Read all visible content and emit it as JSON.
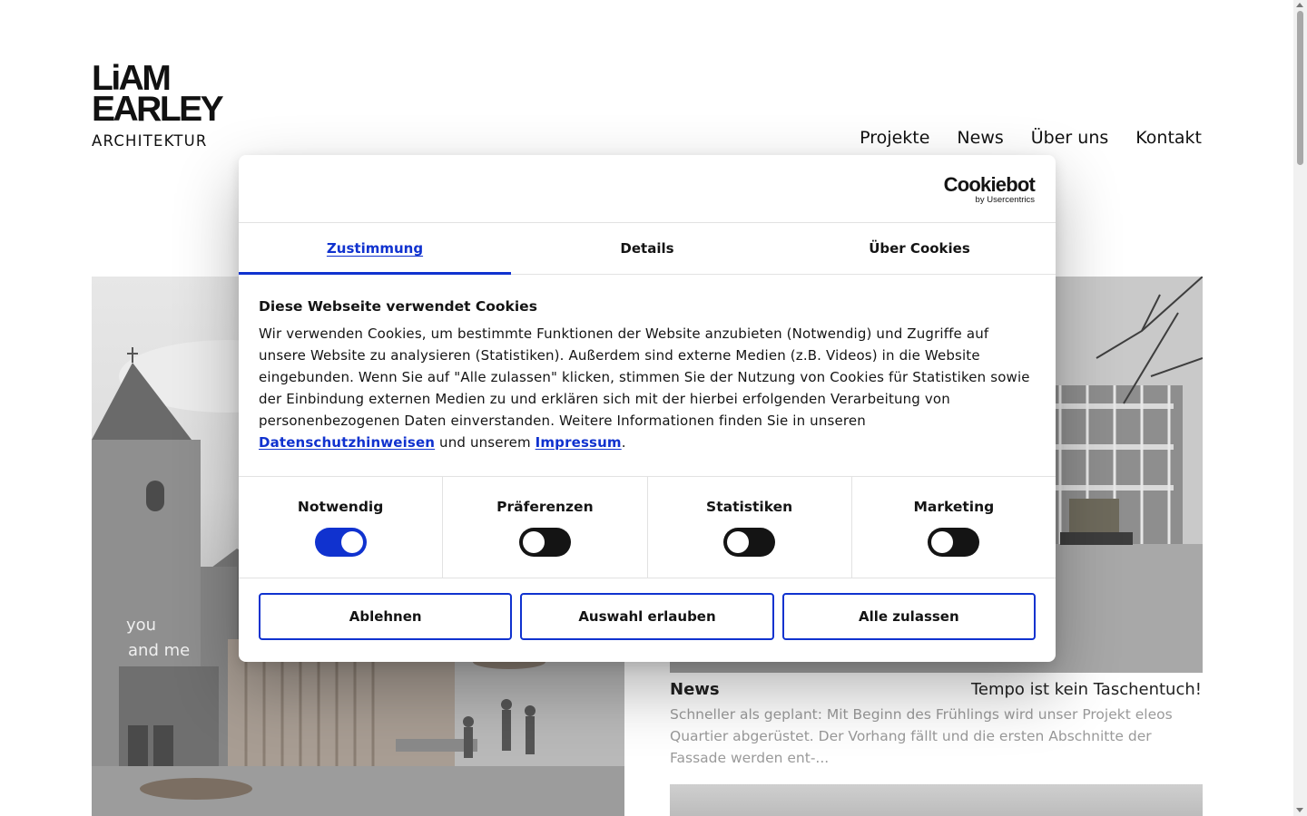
{
  "site": {
    "logo": {
      "line1": "LiAM",
      "line2": "EARLEY",
      "line3": "ARCHITEKTUR"
    },
    "nav": [
      {
        "label": "Projekte"
      },
      {
        "label": "News"
      },
      {
        "label": "Über uns"
      },
      {
        "label": "Kontakt"
      }
    ],
    "news_card": {
      "category": "News",
      "title": "Tempo ist kein Taschentuch!",
      "excerpt": "Schneller als geplant: Mit Beginn des Frühlings wird unser Projekt eleos Quartier abgerüstet. Der Vorhang fällt und die ersten Abschnitte der Fassade werden ent-..."
    },
    "image_text": {
      "line1": "you",
      "line2": "and me"
    }
  },
  "cookie_dialog": {
    "brand": {
      "name": "Cookiebot",
      "sub": "by Usercentrics"
    },
    "tabs": [
      {
        "label": "Zustimmung",
        "active": true
      },
      {
        "label": "Details",
        "active": false
      },
      {
        "label": "Über Cookies",
        "active": false
      }
    ],
    "heading": "Diese Webseite verwendet Cookies",
    "text_before": "Wir verwenden Cookies, um bestimmte Funktionen der Website anzubieten (Notwendig) und Zugriffe auf unsere Website zu analysieren (Statistiken). Außerdem sind externe Medien (z.B. Videos) in die Website eingebunden. Wenn Sie auf \"Alle zulassen\" klicken, stimmen Sie der Nutzung von Cookies für Statistiken sowie der Einbindung externen Medien zu und erklären sich mit der hierbei erfolgenden Verarbeitung von personenbezogenen Daten einverstanden. Weitere Informationen finden Sie in unseren ",
    "link_privacy": "Datenschutzhinweisen",
    "text_middle": " und unserem ",
    "link_imprint": "Impressum",
    "text_after": ".",
    "categories": [
      {
        "label": "Notwendig",
        "enabled": true
      },
      {
        "label": "Präferenzen",
        "enabled": false
      },
      {
        "label": "Statistiken",
        "enabled": false
      },
      {
        "label": "Marketing",
        "enabled": false
      }
    ],
    "buttons": {
      "decline": "Ablehnen",
      "allow_selection": "Auswahl erlauben",
      "allow_all": "Alle zulassen"
    },
    "colors": {
      "accent": "#1032cf",
      "toggle_off": "#141414",
      "text": "#141414"
    }
  }
}
